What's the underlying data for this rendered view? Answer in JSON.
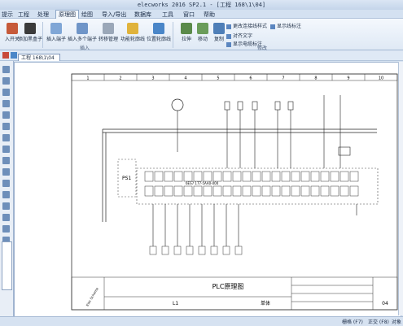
{
  "window": {
    "title": "elecworks 2016 SP2.1 - [工程 168\\1\\04]"
  },
  "menu": [
    "提示",
    "工程",
    "处理",
    "原理图",
    "绘图",
    "导入/导出",
    "数据库",
    "工具",
    "窗口",
    "帮助"
  ],
  "ribbon": {
    "buttons": [
      "入开关",
      "添加黑盒子",
      "插入端子",
      "插入多个端子",
      "转移管理",
      "功能轮廓线",
      "位置轮廓线",
      "拉伸",
      "移动",
      "复制"
    ],
    "small_items": [
      "更改连接线样式",
      "显示线标注",
      "对齐文字",
      "显示电缆标注"
    ],
    "group_labels": [
      "插入",
      "修改"
    ]
  },
  "document_tab": "工程 168\\1\\04",
  "drawing": {
    "column_numbers": [
      "1",
      "2",
      "3",
      "4",
      "5",
      "6",
      "7",
      "8",
      "9",
      "10"
    ],
    "psu_label": "PS1",
    "plc_label": "6ES7 177-5AA0-000",
    "title_block_title": "PLC原理图",
    "title_block_location": "L1",
    "title_block_sheet": "04",
    "title_block_designation": "单体",
    "title_block_footer": "Elec Schema"
  },
  "status": {
    "items": [
      "栅格 (F7)",
      "正交 (F8)",
      "对象"
    ]
  }
}
